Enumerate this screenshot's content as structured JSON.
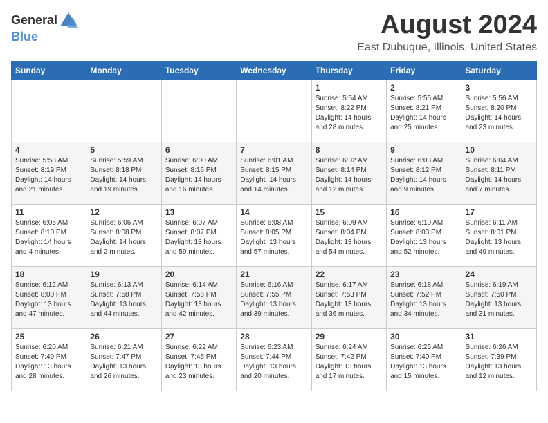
{
  "header": {
    "logo_general": "General",
    "logo_blue": "Blue",
    "month_year": "August 2024",
    "location": "East Dubuque, Illinois, United States"
  },
  "weekdays": [
    "Sunday",
    "Monday",
    "Tuesday",
    "Wednesday",
    "Thursday",
    "Friday",
    "Saturday"
  ],
  "weeks": [
    [
      {
        "day": "",
        "info": ""
      },
      {
        "day": "",
        "info": ""
      },
      {
        "day": "",
        "info": ""
      },
      {
        "day": "",
        "info": ""
      },
      {
        "day": "1",
        "info": "Sunrise: 5:54 AM\nSunset: 8:22 PM\nDaylight: 14 hours and 28 minutes."
      },
      {
        "day": "2",
        "info": "Sunrise: 5:55 AM\nSunset: 8:21 PM\nDaylight: 14 hours and 25 minutes."
      },
      {
        "day": "3",
        "info": "Sunrise: 5:56 AM\nSunset: 8:20 PM\nDaylight: 14 hours and 23 minutes."
      }
    ],
    [
      {
        "day": "4",
        "info": "Sunrise: 5:58 AM\nSunset: 8:19 PM\nDaylight: 14 hours and 21 minutes."
      },
      {
        "day": "5",
        "info": "Sunrise: 5:59 AM\nSunset: 8:18 PM\nDaylight: 14 hours and 19 minutes."
      },
      {
        "day": "6",
        "info": "Sunrise: 6:00 AM\nSunset: 8:16 PM\nDaylight: 14 hours and 16 minutes."
      },
      {
        "day": "7",
        "info": "Sunrise: 6:01 AM\nSunset: 8:15 PM\nDaylight: 14 hours and 14 minutes."
      },
      {
        "day": "8",
        "info": "Sunrise: 6:02 AM\nSunset: 8:14 PM\nDaylight: 14 hours and 12 minutes."
      },
      {
        "day": "9",
        "info": "Sunrise: 6:03 AM\nSunset: 8:12 PM\nDaylight: 14 hours and 9 minutes."
      },
      {
        "day": "10",
        "info": "Sunrise: 6:04 AM\nSunset: 8:11 PM\nDaylight: 14 hours and 7 minutes."
      }
    ],
    [
      {
        "day": "11",
        "info": "Sunrise: 6:05 AM\nSunset: 8:10 PM\nDaylight: 14 hours and 4 minutes."
      },
      {
        "day": "12",
        "info": "Sunrise: 6:06 AM\nSunset: 8:08 PM\nDaylight: 14 hours and 2 minutes."
      },
      {
        "day": "13",
        "info": "Sunrise: 6:07 AM\nSunset: 8:07 PM\nDaylight: 13 hours and 59 minutes."
      },
      {
        "day": "14",
        "info": "Sunrise: 6:08 AM\nSunset: 8:05 PM\nDaylight: 13 hours and 57 minutes."
      },
      {
        "day": "15",
        "info": "Sunrise: 6:09 AM\nSunset: 8:04 PM\nDaylight: 13 hours and 54 minutes."
      },
      {
        "day": "16",
        "info": "Sunrise: 6:10 AM\nSunset: 8:03 PM\nDaylight: 13 hours and 52 minutes."
      },
      {
        "day": "17",
        "info": "Sunrise: 6:11 AM\nSunset: 8:01 PM\nDaylight: 13 hours and 49 minutes."
      }
    ],
    [
      {
        "day": "18",
        "info": "Sunrise: 6:12 AM\nSunset: 8:00 PM\nDaylight: 13 hours and 47 minutes."
      },
      {
        "day": "19",
        "info": "Sunrise: 6:13 AM\nSunset: 7:58 PM\nDaylight: 13 hours and 44 minutes."
      },
      {
        "day": "20",
        "info": "Sunrise: 6:14 AM\nSunset: 7:56 PM\nDaylight: 13 hours and 42 minutes."
      },
      {
        "day": "21",
        "info": "Sunrise: 6:16 AM\nSunset: 7:55 PM\nDaylight: 13 hours and 39 minutes."
      },
      {
        "day": "22",
        "info": "Sunrise: 6:17 AM\nSunset: 7:53 PM\nDaylight: 13 hours and 36 minutes."
      },
      {
        "day": "23",
        "info": "Sunrise: 6:18 AM\nSunset: 7:52 PM\nDaylight: 13 hours and 34 minutes."
      },
      {
        "day": "24",
        "info": "Sunrise: 6:19 AM\nSunset: 7:50 PM\nDaylight: 13 hours and 31 minutes."
      }
    ],
    [
      {
        "day": "25",
        "info": "Sunrise: 6:20 AM\nSunset: 7:49 PM\nDaylight: 13 hours and 28 minutes."
      },
      {
        "day": "26",
        "info": "Sunrise: 6:21 AM\nSunset: 7:47 PM\nDaylight: 13 hours and 26 minutes."
      },
      {
        "day": "27",
        "info": "Sunrise: 6:22 AM\nSunset: 7:45 PM\nDaylight: 13 hours and 23 minutes."
      },
      {
        "day": "28",
        "info": "Sunrise: 6:23 AM\nSunset: 7:44 PM\nDaylight: 13 hours and 20 minutes."
      },
      {
        "day": "29",
        "info": "Sunrise: 6:24 AM\nSunset: 7:42 PM\nDaylight: 13 hours and 17 minutes."
      },
      {
        "day": "30",
        "info": "Sunrise: 6:25 AM\nSunset: 7:40 PM\nDaylight: 13 hours and 15 minutes."
      },
      {
        "day": "31",
        "info": "Sunrise: 6:26 AM\nSunset: 7:39 PM\nDaylight: 13 hours and 12 minutes."
      }
    ]
  ]
}
